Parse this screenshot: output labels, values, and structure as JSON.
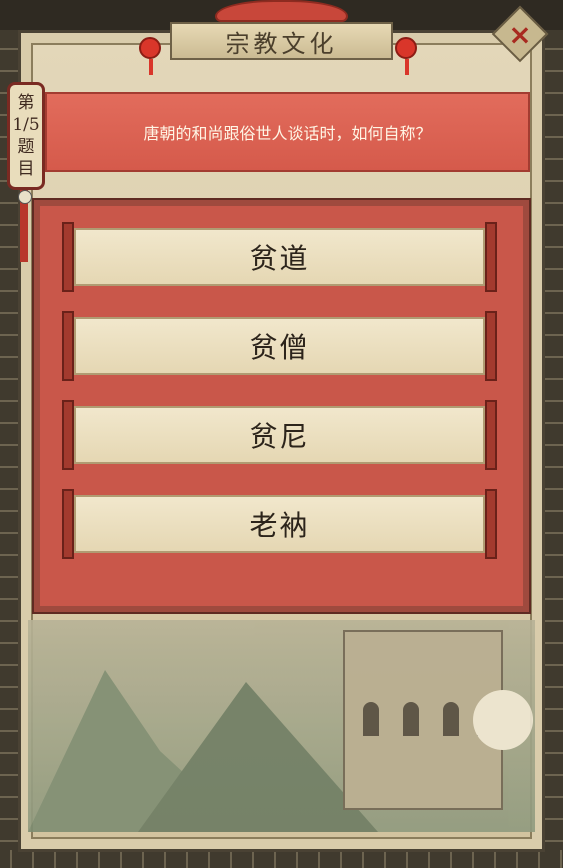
{
  "header": {
    "title": "宗教文化"
  },
  "progress": {
    "prefix": "第",
    "count": "1/5",
    "suffix1": "题",
    "suffix2": "目"
  },
  "question": {
    "text": "唐朝的和尚跟俗世人谈话时，如何自称？"
  },
  "options": [
    {
      "label": "贫道"
    },
    {
      "label": "贫僧"
    },
    {
      "label": "贫尼"
    },
    {
      "label": "老衲"
    }
  ],
  "icons": {
    "close": "close-icon",
    "lantern": "lantern-icon"
  },
  "colors": {
    "accent": "#d55a4b",
    "scroll": "#efe4c6",
    "border": "#6e6147"
  }
}
